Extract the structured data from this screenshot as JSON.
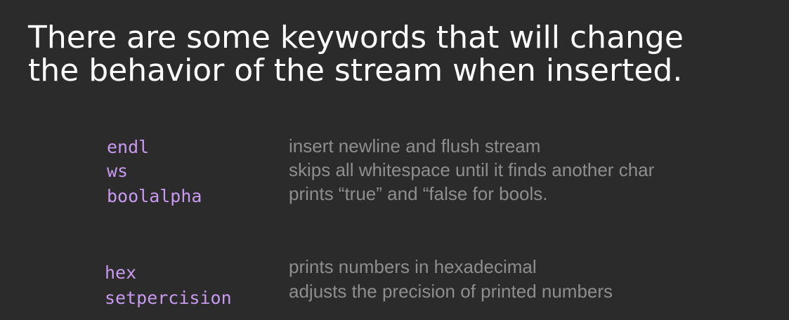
{
  "title": {
    "line1": "There are some keywords that will change",
    "line2": "the behavior of the stream when inserted."
  },
  "group1": [
    {
      "keyword": "endl",
      "description": "insert newline and flush stream"
    },
    {
      "keyword": "ws",
      "description": "skips all whitespace until it finds another char"
    },
    {
      "keyword": "boolalpha",
      "description": "prints “true” and “false for bools."
    }
  ],
  "group2": [
    {
      "keyword": "hex",
      "description": "prints numbers in hexadecimal"
    },
    {
      "keyword": "setpercision",
      "description": "adjusts the precision of printed numbers"
    }
  ],
  "colors": {
    "background": "#2b2b2b",
    "title": "#ffffff",
    "keyword": "#c79af0",
    "description": "#8e8e8e"
  }
}
